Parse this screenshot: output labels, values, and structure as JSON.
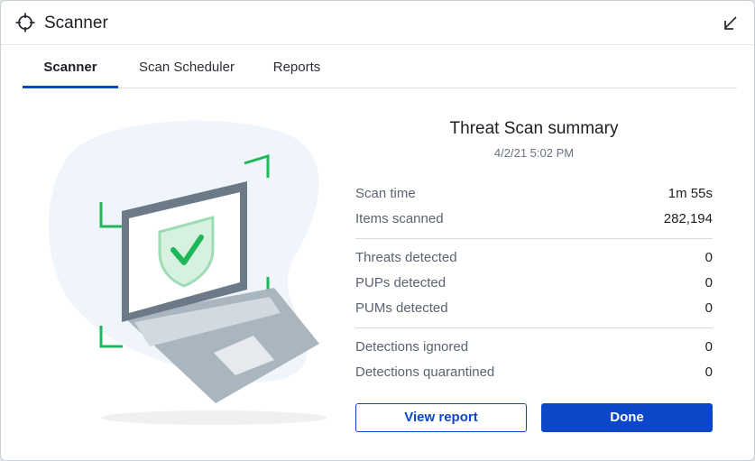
{
  "window": {
    "title": "Scanner"
  },
  "tabs": [
    {
      "label": "Scanner",
      "active": true
    },
    {
      "label": "Scan Scheduler",
      "active": false
    },
    {
      "label": "Reports",
      "active": false
    }
  ],
  "summary": {
    "title": "Threat Scan summary",
    "date": "4/2/21 5:02 PM",
    "groups": [
      [
        {
          "label": "Scan time",
          "value": "1m 55s"
        },
        {
          "label": "Items scanned",
          "value": "282,194"
        }
      ],
      [
        {
          "label": "Threats detected",
          "value": "0"
        },
        {
          "label": "PUPs detected",
          "value": "0"
        },
        {
          "label": "PUMs detected",
          "value": "0"
        }
      ],
      [
        {
          "label": "Detections ignored",
          "value": "0"
        },
        {
          "label": "Detections quarantined",
          "value": "0"
        }
      ]
    ]
  },
  "buttons": {
    "view_report": "View report",
    "done": "Done"
  },
  "icons": {
    "app": "crosshair-icon",
    "minimize": "arrow-down-left-icon",
    "illustration": "laptop-shield-check-icon"
  },
  "colors": {
    "accent": "#0d47c9",
    "success": "#1eb85a"
  }
}
